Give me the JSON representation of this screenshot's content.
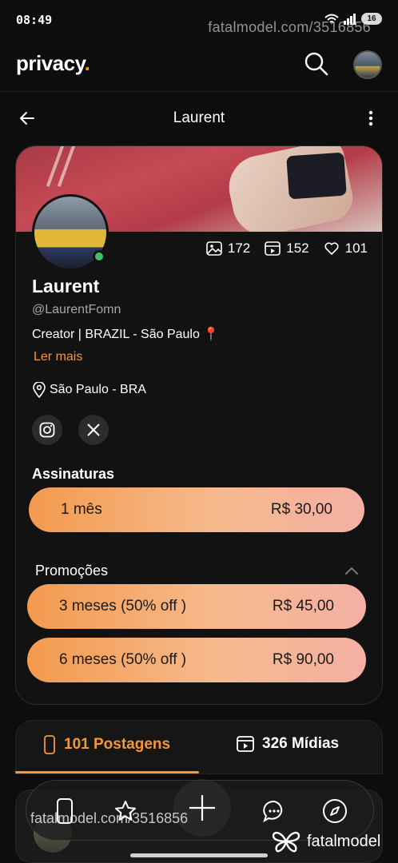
{
  "status_bar": {
    "time": "08:49",
    "battery": "16"
  },
  "watermark": {
    "text": "fatalmodel.com/3516856",
    "brand": "fatalmodel"
  },
  "app": {
    "logo": "privacy",
    "logo_dot": "."
  },
  "nav": {
    "title": "Laurent"
  },
  "profile": {
    "name": "Laurent",
    "handle": "@LaurentFomn",
    "bio": "Creator | BRAZIL - São Paulo 📍",
    "read_more": "Ler mais",
    "location": "São Paulo - BRA",
    "stats": {
      "photos": "172",
      "videos": "152",
      "likes": "101"
    },
    "online": true
  },
  "subscriptions": {
    "title": "Assinaturas",
    "plans": [
      {
        "label": "1 mês",
        "price": "R$ 30,00"
      }
    ]
  },
  "promotions": {
    "title": "Promoções",
    "plans": [
      {
        "label": "3 meses (50% off )",
        "price": "R$ 45,00"
      },
      {
        "label": "6 meses (50% off )",
        "price": "R$ 90,00"
      }
    ]
  },
  "tabs": [
    {
      "label": "101 Postagens",
      "active": true
    },
    {
      "label": "326 Mídias",
      "active": false
    }
  ],
  "colors": {
    "accent": "#f5963c",
    "background": "#0d0d0d",
    "online": "#37c46b"
  }
}
